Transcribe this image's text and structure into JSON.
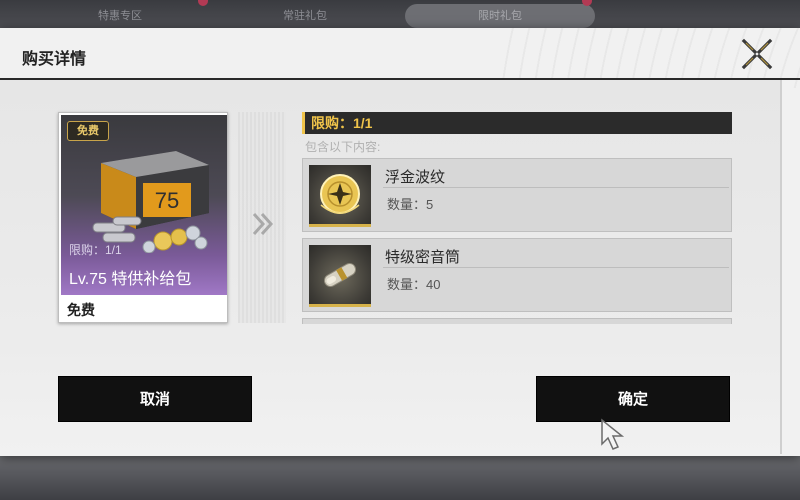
{
  "background_tabs": [
    "特惠专区",
    "常驻礼包",
    "限时礼包"
  ],
  "dialog": {
    "title": "购买详情",
    "close_icon": "close-x-icon"
  },
  "item_card": {
    "badge": "免费",
    "crate_number": "75",
    "limit_text": "限购：1/1",
    "name": "Lv.75 特供补给包",
    "price": "免费"
  },
  "contents": {
    "limit_text": "限购：1/1",
    "header": "包含以下内容:",
    "qty_label": "数量：",
    "items": [
      {
        "name": "浮金波纹",
        "quantity": "5",
        "icon": "gold-ripple-coin-icon"
      },
      {
        "name": "特级密音筒",
        "quantity": "40",
        "icon": "sound-capsule-icon"
      }
    ]
  },
  "buttons": {
    "cancel": "取消",
    "confirm": "确定"
  },
  "colors": {
    "accent_gold": "#f0c44a",
    "button_bg": "#111111",
    "card_purple": "#a078c6"
  }
}
